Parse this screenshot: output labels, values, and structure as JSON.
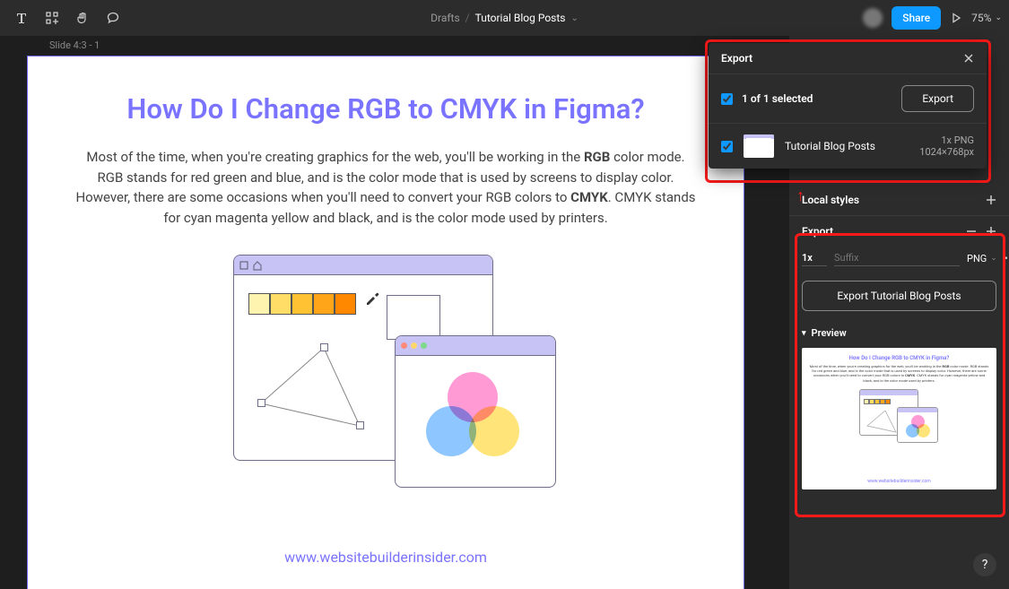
{
  "toolbar": {
    "project": "Drafts",
    "file": "Tutorial Blog Posts",
    "share_label": "Share",
    "zoom": "75%"
  },
  "canvas": {
    "frame_label": "Slide 4:3 - 1",
    "slide": {
      "title": "How Do I Change RGB to CMYK in Figma?",
      "body_pre": "Most of the time, when you're creating graphics for the web, you'll be working in the ",
      "rgb": "RGB",
      "body_mid": " color mode. RGB stands for red green and blue, and is the color mode that is used by screens to display color. However, there are some occasions when you'll need to convert your RGB colors to ",
      "cmyk": "CMYK",
      "body_post": ". CMYK stands for cyan magenta yellow and black, and is the color mode used by printers.",
      "footer": "www.websitebuilderinsider.com"
    }
  },
  "export_popover": {
    "title": "Export",
    "selected_text": "1 of 1 selected",
    "export_btn": "Export",
    "item": {
      "title": "Tutorial Blog Posts",
      "scale": "1x PNG",
      "dims": "1024×768px"
    }
  },
  "sidebar": {
    "local_styles": "Local styles",
    "export": {
      "title": "Export",
      "scale": "1x",
      "suffix_placeholder": "Suffix",
      "format": "PNG",
      "big_button": "Export Tutorial Blog Posts",
      "preview_label": "Preview"
    }
  },
  "colors": {
    "accent": "#0d99ff",
    "violet": "#7a73ff",
    "highlight": "#ff1a1a"
  }
}
